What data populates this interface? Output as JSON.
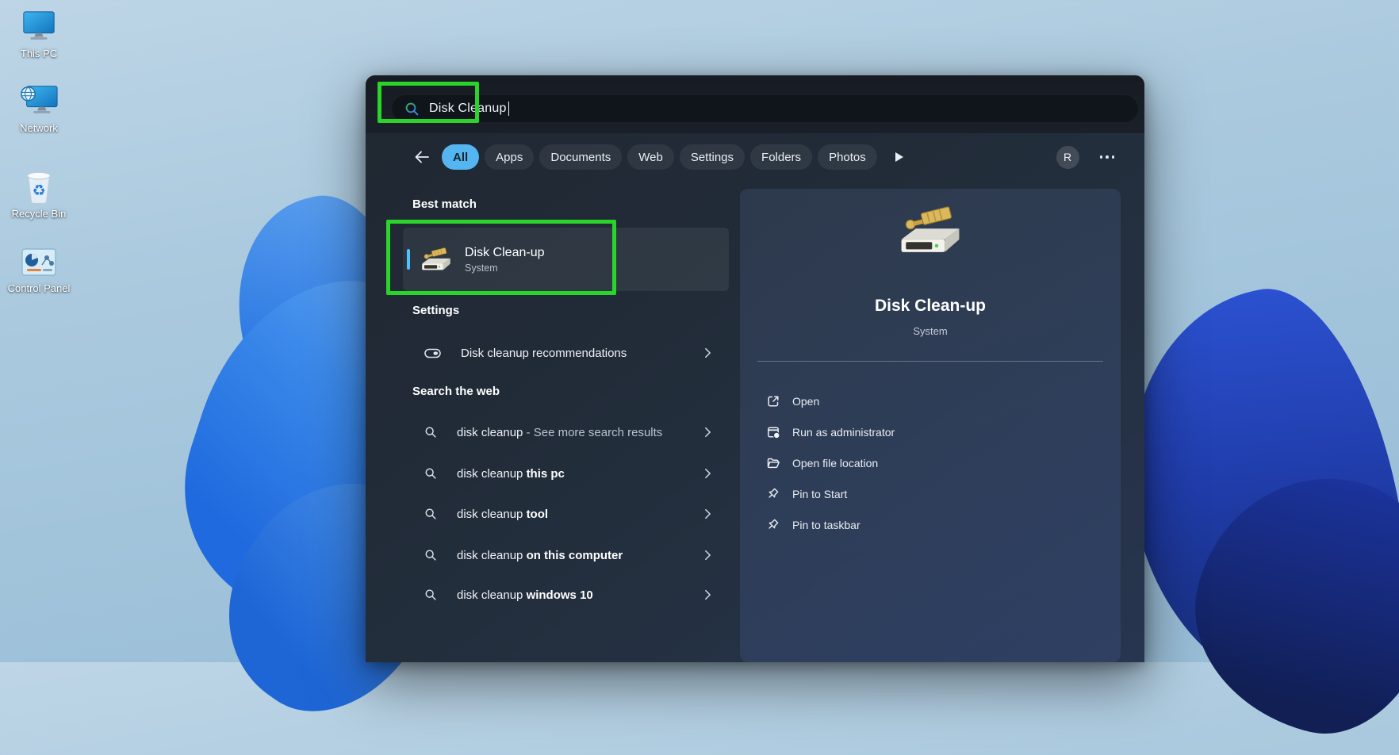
{
  "desktop": {
    "icons": [
      {
        "label": "This PC",
        "icon": "this-pc-icon"
      },
      {
        "label": "Network",
        "icon": "network-icon"
      },
      {
        "label": "Recycle Bin",
        "icon": "recycle-bin-icon"
      },
      {
        "label": "Control Panel",
        "icon": "control-panel-icon"
      }
    ]
  },
  "search": {
    "value": "Disk Cleanup",
    "icon": "search-icon"
  },
  "tabs": {
    "items": [
      "All",
      "Apps",
      "Documents",
      "Web",
      "Settings",
      "Folders",
      "Photos"
    ],
    "active": "All",
    "profile_initial": "R",
    "more_icon": "ellipsis",
    "overflow_icon": "play-triangle"
  },
  "results": {
    "best_match_heading": "Best match",
    "best_match": {
      "title": "Disk Clean-up",
      "subtitle": "System",
      "icon": "disk-cleanup-icon"
    },
    "settings_heading": "Settings",
    "settings_items": [
      {
        "label": "Disk cleanup recommendations",
        "icon": "storage-drive-icon"
      }
    ],
    "web_heading": "Search the web",
    "web_items": [
      {
        "prefix": "disk cleanup",
        "suffix": " - See more search results",
        "muted": true
      },
      {
        "prefix": "disk cleanup ",
        "suffix": "this pc"
      },
      {
        "prefix": "disk cleanup ",
        "suffix": "tool"
      },
      {
        "prefix": "disk cleanup ",
        "suffix": "on this computer"
      },
      {
        "prefix": "disk cleanup ",
        "suffix": "windows 10"
      }
    ]
  },
  "detail": {
    "title": "Disk Clean-up",
    "subtitle": "System",
    "icon": "disk-cleanup-icon",
    "actions": [
      {
        "label": "Open",
        "icon": "open-external-icon"
      },
      {
        "label": "Run as administrator",
        "icon": "admin-window-icon"
      },
      {
        "label": "Open file location",
        "icon": "folder-open-icon"
      },
      {
        "label": "Pin to Start",
        "icon": "pin-icon"
      },
      {
        "label": "Pin to taskbar",
        "icon": "pin-icon"
      }
    ]
  },
  "colors": {
    "accent_blue": "#4cc2ff",
    "active_tab_bg": "#55b5f0",
    "annotation_green": "#2bd42b",
    "panel_bg": "#222c39",
    "wallpaper_blue": "#2d7ce3"
  }
}
